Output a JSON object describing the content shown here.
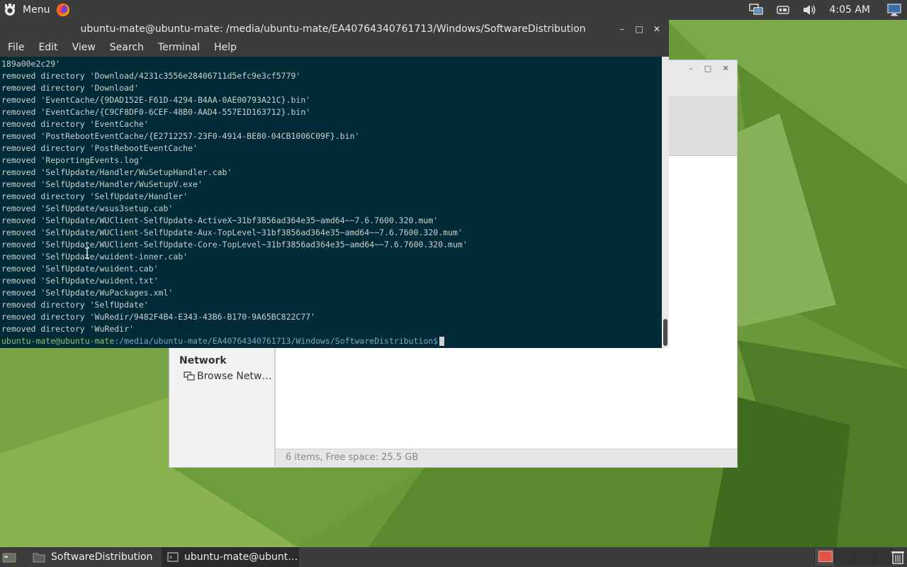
{
  "top_panel": {
    "menu_label": "Menu",
    "clock": "4:05 AM"
  },
  "terminal": {
    "title": "ubuntu-mate@ubuntu-mate: /media/ubuntu-mate/EA40764340761713/Windows/SoftwareDistribution",
    "menu": [
      "File",
      "Edit",
      "View",
      "Search",
      "Terminal",
      "Help"
    ],
    "lines": [
      "189a00e2c29'",
      "removed directory 'Download/4231c3556e28406711d5efc9e3cf5779'",
      "removed directory 'Download'",
      "removed 'EventCache/{9DAD152E-F61D-4294-B4AA-0AE00793A21C}.bin'",
      "removed 'EventCache/{C9CF8DF0-6CEF-48B0-AAD4-557E1D163712}.bin'",
      "removed directory 'EventCache'",
      "removed 'PostRebootEventCache/{E2712257-23F0-4914-BE80-04CB1006C09F}.bin'",
      "removed directory 'PostRebootEventCache'",
      "removed 'ReportingEvents.log'",
      "removed 'SelfUpdate/Handler/WuSetupHandler.cab'",
      "removed 'SelfUpdate/Handler/WuSetupV.exe'",
      "removed directory 'SelfUpdate/Handler'",
      "removed 'SelfUpdate/wsus3setup.cab'",
      "removed 'SelfUpdate/WUClient-SelfUpdate-ActiveX~31bf3856ad364e35~amd64~~7.6.7600.320.mum'",
      "removed 'SelfUpdate/WUClient-SelfUpdate-Aux-TopLevel~31bf3856ad364e35~amd64~~7.6.7600.320.mum'",
      "removed 'SelfUpdate/WUClient-SelfUpdate-Core-TopLevel~31bf3856ad364e35~amd64~~7.6.7600.320.mum'",
      "removed 'SelfUpdate/wuident-inner.cab'",
      "removed 'SelfUpdate/wuident.cab'",
      "removed 'SelfUpdate/wuident.txt'",
      "removed 'SelfUpdate/WuPackages.xml'",
      "removed directory 'SelfUpdate'",
      "removed directory 'WuRedir/9482F4B4-E343-43B6-B170-9A65BC822C77'",
      "removed directory 'WuRedir'"
    ],
    "prompt_user": "ubuntu-mate@ubuntu-mate",
    "prompt_path": ":/media/ubuntu-mate/EA40764340761713/Windows/SoftwareDistribution$"
  },
  "file_manager": {
    "network_heading": "Network",
    "browse_network": "Browse Netw…",
    "status": "6 items, Free space: 25.5 GB"
  },
  "taskbar": {
    "files_task": "SoftwareDistribution",
    "terminal_task": "ubuntu-mate@ubunt…"
  },
  "colors": {
    "terminal_bg": "#012b36",
    "panel_bg": "#3c3c3c",
    "prompt_user": "#8ec26a",
    "prompt_path": "#7aa7c7"
  }
}
